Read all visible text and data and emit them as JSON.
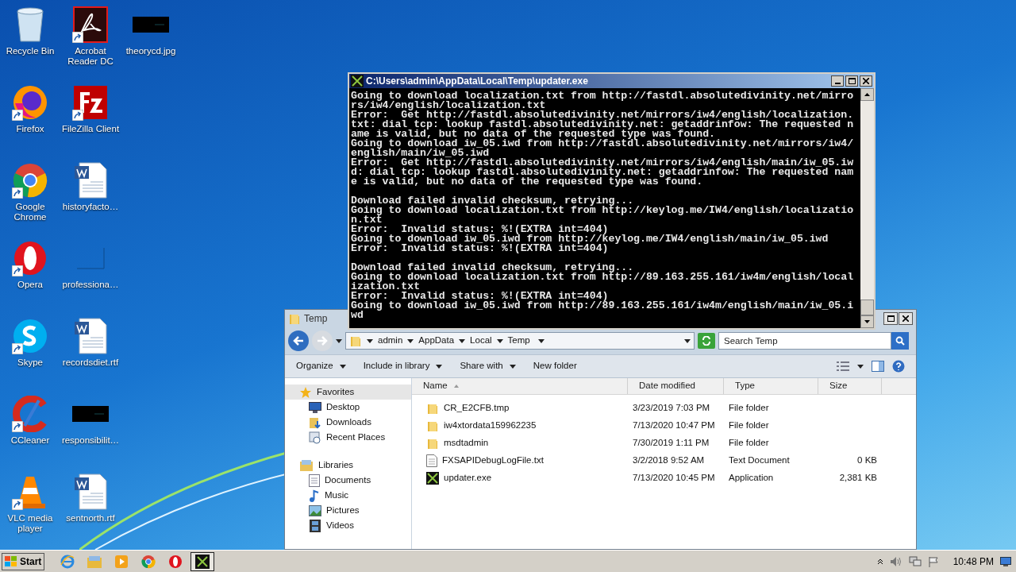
{
  "desktop_columns": [
    [
      {
        "label": "Recycle Bin",
        "kind": "recycle",
        "shortcut": false
      },
      {
        "label": "Firefox",
        "kind": "firefox",
        "shortcut": true
      },
      {
        "label": "Google Chrome",
        "kind": "chrome",
        "shortcut": true
      },
      {
        "label": "Opera",
        "kind": "opera",
        "shortcut": true
      },
      {
        "label": "Skype",
        "kind": "skype",
        "shortcut": true
      },
      {
        "label": "CCleaner",
        "kind": "ccleaner",
        "shortcut": true
      },
      {
        "label": "VLC media player",
        "kind": "vlc",
        "shortcut": true
      }
    ],
    [
      {
        "label": "Acrobat Reader DC",
        "kind": "acrobat",
        "shortcut": true
      },
      {
        "label": "FileZilla Client",
        "kind": "filezilla",
        "shortcut": true
      },
      {
        "label": "historyfacto…",
        "kind": "word",
        "shortcut": false
      },
      {
        "label": "professiona…",
        "kind": "blank",
        "shortcut": false
      },
      {
        "label": "recordsdiet.rtf",
        "kind": "word",
        "shortcut": false
      },
      {
        "label": "responsibilit…",
        "kind": "image",
        "shortcut": false
      },
      {
        "label": "sentnorth.rtf",
        "kind": "word",
        "shortcut": false
      }
    ],
    [
      {
        "label": "theorycd.jpg",
        "kind": "image",
        "shortcut": false
      }
    ]
  ],
  "explorer": {
    "title": "Temp",
    "breadcrumb": [
      "admin",
      "AppData",
      "Local",
      "Temp"
    ],
    "search": {
      "placeholder": "Search Temp"
    },
    "toolbar": [
      {
        "label": "Organize",
        "dropdown": true
      },
      {
        "label": "Include in library",
        "dropdown": true
      },
      {
        "label": "Share with",
        "dropdown": true
      },
      {
        "label": "New folder",
        "dropdown": false
      }
    ],
    "nav": [
      {
        "label": "Favorites",
        "kind": "star",
        "selected": true,
        "children": [
          {
            "label": "Desktop",
            "kind": "desktop",
            "selected": false
          },
          {
            "label": "Downloads",
            "kind": "downloads",
            "selected": false
          },
          {
            "label": "Recent Places",
            "kind": "recent",
            "selected": false
          }
        ]
      },
      {
        "label": "Libraries",
        "kind": "libraries",
        "selected": false,
        "children": [
          {
            "label": "Documents",
            "kind": "documents",
            "selected": false
          },
          {
            "label": "Music",
            "kind": "music",
            "selected": false
          },
          {
            "label": "Pictures",
            "kind": "pictures",
            "selected": false
          },
          {
            "label": "Videos",
            "kind": "videos",
            "selected": false
          }
        ]
      }
    ],
    "columns": [
      {
        "label": "Name",
        "sorted": true
      },
      {
        "label": "Date modified",
        "sorted": false
      },
      {
        "label": "Type",
        "sorted": false
      },
      {
        "label": "Size",
        "sorted": false
      }
    ],
    "files": [
      {
        "name": "CR_E2CFB.tmp",
        "date": "3/23/2019 7:03 PM",
        "type": "File folder",
        "kind": "folder"
      },
      {
        "name": "iw4xtordata159962235",
        "date": "7/13/2020 10:47 PM",
        "type": "File folder",
        "kind": "folder"
      },
      {
        "name": "msdtadmin",
        "date": "7/30/2019 1:11 PM",
        "type": "File folder",
        "kind": "folder"
      },
      {
        "name": "FXSAPIDebugLogFile.txt",
        "date": "3/2/2018 9:52 AM",
        "type": "Text Document",
        "size": "0 KB",
        "kind": "text"
      },
      {
        "name": "updater.exe",
        "date": "7/13/2020 10:45 PM",
        "type": "Application",
        "size": "2,381 KB",
        "kind": "app"
      }
    ]
  },
  "console": {
    "title": "C:\\Users\\admin\\AppData\\Local\\Temp\\updater.exe",
    "blocks": [
      [
        "Going to download localization.txt from http://fastdl.absolutedivinity.net/mirro",
        "rs/iw4/english/localization.txt",
        "Error:  Get http://fastdl.absolutedivinity.net/mirrors/iw4/english/localization.",
        "txt: dial tcp: lookup fastdl.absolutedivinity.net: getaddrinfow: The requested n",
        "ame is valid, but no data of the requested type was found.",
        "Going to download iw_05.iwd from http://fastdl.absolutedivinity.net/mirrors/iw4/",
        "english/main/iw_05.iwd",
        "Error:  Get http://fastdl.absolutedivinity.net/mirrors/iw4/english/main/iw_05.iw",
        "d: dial tcp: lookup fastdl.absolutedivinity.net: getaddrinfow: The requested nam",
        "e is valid, but no data of the requested type was found."
      ],
      [
        "Download failed invalid checksum, retrying...",
        "Going to download localization.txt from http://keylog.me/IW4/english/localizatio",
        "n.txt",
        "Error:  Invalid status: %!(EXTRA int=404)",
        "Going to download iw_05.iwd from http://keylog.me/IW4/english/main/iw_05.iwd",
        "Error:  Invalid status: %!(EXTRA int=404)"
      ],
      [
        "Download failed invalid checksum, retrying...",
        "Going to download localization.txt from http://89.163.255.161/iw4m/english/local",
        "ization.txt",
        "Error:  Invalid status: %!(EXTRA int=404)",
        "Going to download iw_05.iwd from http://89.163.255.161/iw4m/english/main/iw_05.i",
        "wd"
      ]
    ]
  },
  "taskbar": {
    "start": "Start",
    "apps": [
      {
        "kind": "ie",
        "active": false
      },
      {
        "kind": "explorer",
        "active": false
      },
      {
        "kind": "media",
        "active": false
      },
      {
        "kind": "chrome",
        "active": false
      },
      {
        "kind": "opera",
        "active": false
      },
      {
        "kind": "console",
        "active": true
      }
    ],
    "clock": "10:48 PM"
  }
}
